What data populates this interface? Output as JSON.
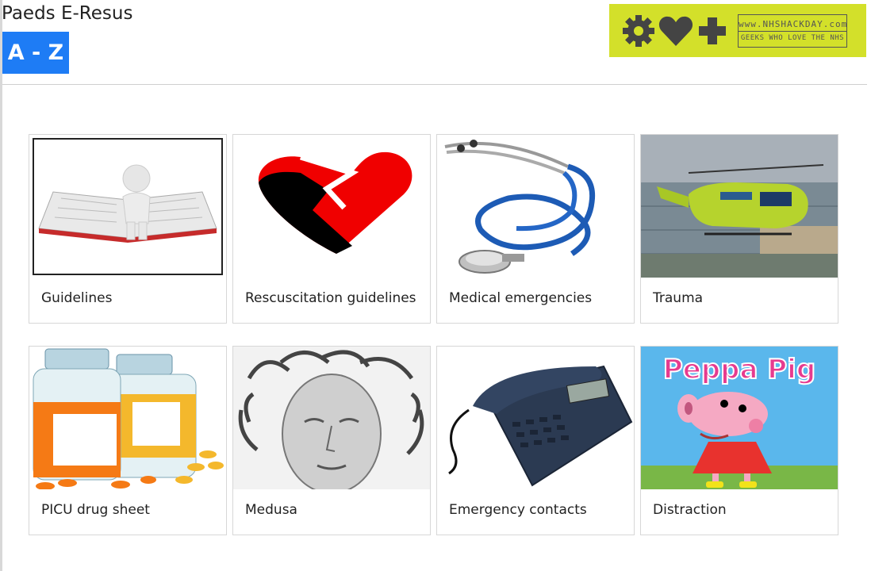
{
  "header": {
    "title": "Paeds E-Resus",
    "az_label": "A - Z"
  },
  "logo": {
    "top_text": "www.NHSHACKDAY.com",
    "bottom_text": "GEEKS WHO LOVE THE NHS",
    "background": "#d3e02a"
  },
  "cards": [
    {
      "label": "Guidelines",
      "image": "book-figure-image"
    },
    {
      "label": "Rescuscitation guidelines",
      "image": "broken-heart-image"
    },
    {
      "label": "Medical emergencies",
      "image": "stethoscope-image"
    },
    {
      "label": "Trauma",
      "image": "helicopter-image"
    },
    {
      "label": "PICU drug sheet",
      "image": "pill-bottles-image"
    },
    {
      "label": "Medusa",
      "image": "medusa-image"
    },
    {
      "label": "Emergency contacts",
      "image": "telephone-image"
    },
    {
      "label": "Distraction",
      "image": "peppa-pig-image"
    }
  ],
  "colors": {
    "accent": "#1e7cf5",
    "logo": "#d3e02a"
  }
}
